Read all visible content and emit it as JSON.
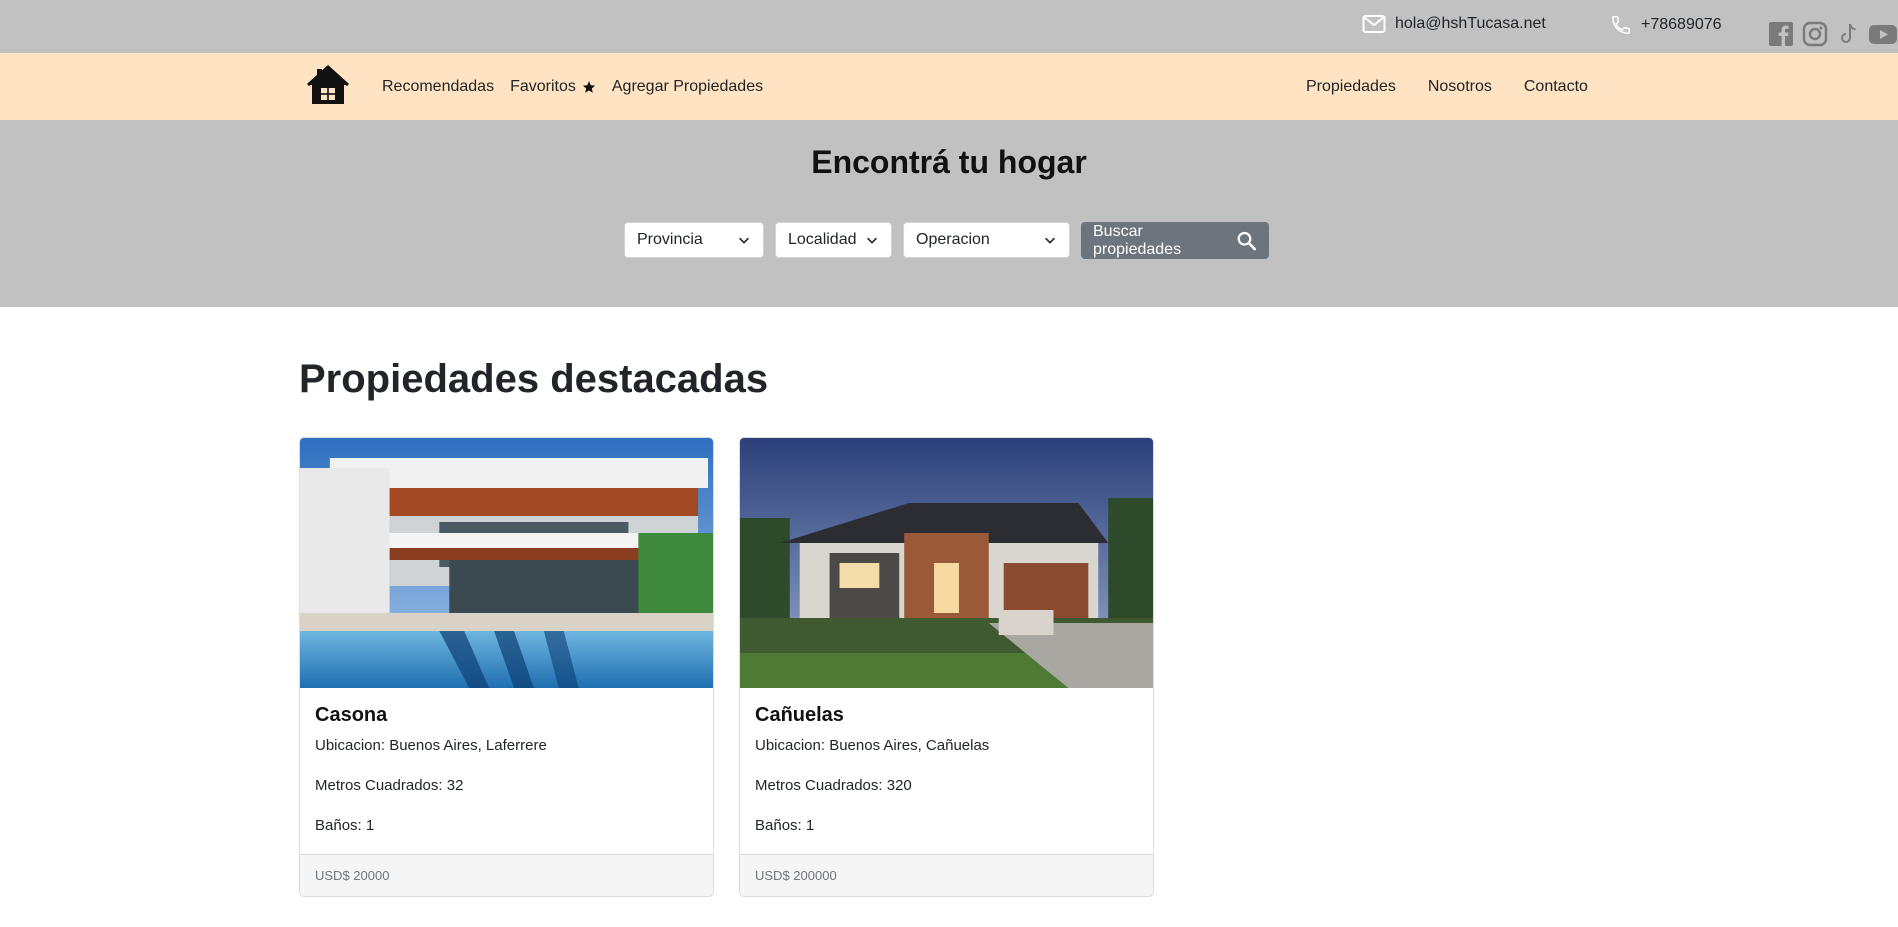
{
  "topbar": {
    "email": "hola@hshTucasa.net",
    "phone": "+78689076",
    "socials": [
      "facebook-icon",
      "instagram-icon",
      "tiktok-icon",
      "youtube-icon"
    ]
  },
  "nav": {
    "left": [
      {
        "label": "Recomendadas"
      },
      {
        "label": "Favoritos"
      },
      {
        "label": "Agregar Propiedades"
      }
    ],
    "right": [
      {
        "label": "Propiedades"
      },
      {
        "label": "Nosotros"
      },
      {
        "label": "Contacto"
      }
    ]
  },
  "hero": {
    "title": "Encontrá tu hogar",
    "filters": {
      "provincia": "Provincia",
      "localidad": "Localidad",
      "operacion": "Operacion"
    },
    "search_label": "Buscar propiedades"
  },
  "featured": {
    "title": "Propiedades destacadas",
    "cards": [
      {
        "title": "Casona",
        "ubicacion": "Ubicacion: Buenos Aires, Laferrere",
        "metros": "Metros Cuadrados: 32",
        "banos": "Baños: 1",
        "price": "USD$ 20000"
      },
      {
        "title": "Cañuelas",
        "ubicacion": "Ubicacion: Buenos Aires, Cañuelas",
        "metros": "Metros Cuadrados: 320",
        "banos": "Baños: 1",
        "price": "USD$ 200000"
      }
    ]
  },
  "colors": {
    "topbar_bg": "#c1c1c1",
    "navbar_bg": "#ffe3c2",
    "search_button_bg": "#6c757d"
  }
}
